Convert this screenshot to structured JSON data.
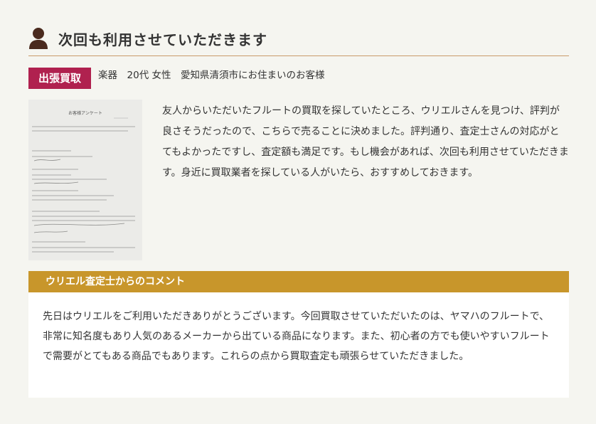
{
  "header": {
    "title": "次回も利用させていただきます",
    "icon": "user-icon"
  },
  "meta": {
    "badge": "出張買取",
    "info": "楽器　20代 女性　愛知県清須市にお住まいのお客様"
  },
  "photo": {
    "heading": "お客様アンケート"
  },
  "review": {
    "text": "友人からいただいたフルートの買取を探していたところ、ウリエルさんを見つけ、評判が良さそうだったので、こちらで売ることに決めました。評判通り、査定士さんの対応がとてもよかったですし、査定額も満足です。もし機会があれば、次回も利用させていただきます。身近に買取業者を探している人がいたら、おすすめしておきます。"
  },
  "comment": {
    "title": "ウリエル査定士からのコメント",
    "text": "先日はウリエルをご利用いただきありがとうございます。今回買取させていただいたのは、ヤマハのフルートで、非常に知名度もあり人気のあるメーカーから出ている商品になります。また、初心者の方でも使いやすいフルートで需要がとてもある商品でもあります。これらの点から買取査定も頑張らせていただきました。"
  },
  "colors": {
    "badge": "#b0214f",
    "comment_bar": "#c8962b",
    "divider": "#c89a6a",
    "icon": "#4a2a1e"
  }
}
